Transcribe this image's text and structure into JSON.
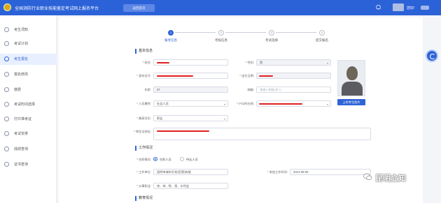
{
  "header": {
    "app_title": "全国消防行业职业技能鉴定考试网上报名平台",
    "top_button": "返回首页",
    "user_name": "您好!"
  },
  "sidebar": {
    "items": [
      {
        "label": "考生须知",
        "icon": "info-icon"
      },
      {
        "label": "考试计划",
        "icon": "calendar-icon"
      },
      {
        "label": "考生报名",
        "icon": "edit-icon"
      },
      {
        "label": "报名修改",
        "icon": "document-icon"
      },
      {
        "label": "缴费",
        "icon": "payment-icon"
      },
      {
        "label": "考试时间选择",
        "icon": "clock-icon"
      },
      {
        "label": "打印准考证",
        "icon": "print-icon"
      },
      {
        "label": "考试安排",
        "icon": "schedule-icon"
      },
      {
        "label": "成绩查询",
        "icon": "score-icon"
      },
      {
        "label": "证书查询",
        "icon": "certificate-icon"
      }
    ],
    "active_index": 2
  },
  "steps": [
    {
      "num": "1",
      "label": "报考信息"
    },
    {
      "num": "2",
      "label": "考核信息"
    },
    {
      "num": "3",
      "label": "考试选择"
    },
    {
      "num": "4",
      "label": "提交报名"
    }
  ],
  "active_step": 0,
  "basic": {
    "title": "基本信息",
    "name_label": "* 姓名:",
    "gender_label": "* 性别:",
    "gender_value": "男",
    "id_label": "* 身份证号:",
    "birth_label": "* 出生日期:",
    "age_label": "年龄:",
    "age_value": "37",
    "email_label": "邮箱:",
    "email_placeholder": "请输入邮箱,如 3...",
    "category_label": "* 人员属性:",
    "category_value": "社会人员",
    "hukou_label": "* 户口所在地:",
    "edu_label": "* 最高学历:",
    "edu_value": "职业",
    "address_label": "* 常住证地址:"
  },
  "photo": {
    "upload_label": "上传考生照片"
  },
  "work": {
    "title": "工作情况",
    "status_label": "* 在职情况:",
    "status_on": "在职人员",
    "status_off": "待业人员",
    "company_label": "* 工作单位:",
    "company_value": "昆明市城市开发(民营)有限",
    "start_label": "* 参加工作时间:",
    "start_value": "2014-06-05",
    "job_label": "* 从事职业:",
    "job_value": "农、林、牧、渔、水利业"
  },
  "education": {
    "title": "教育情况"
  },
  "watermark": {
    "text": "昆明立知"
  }
}
